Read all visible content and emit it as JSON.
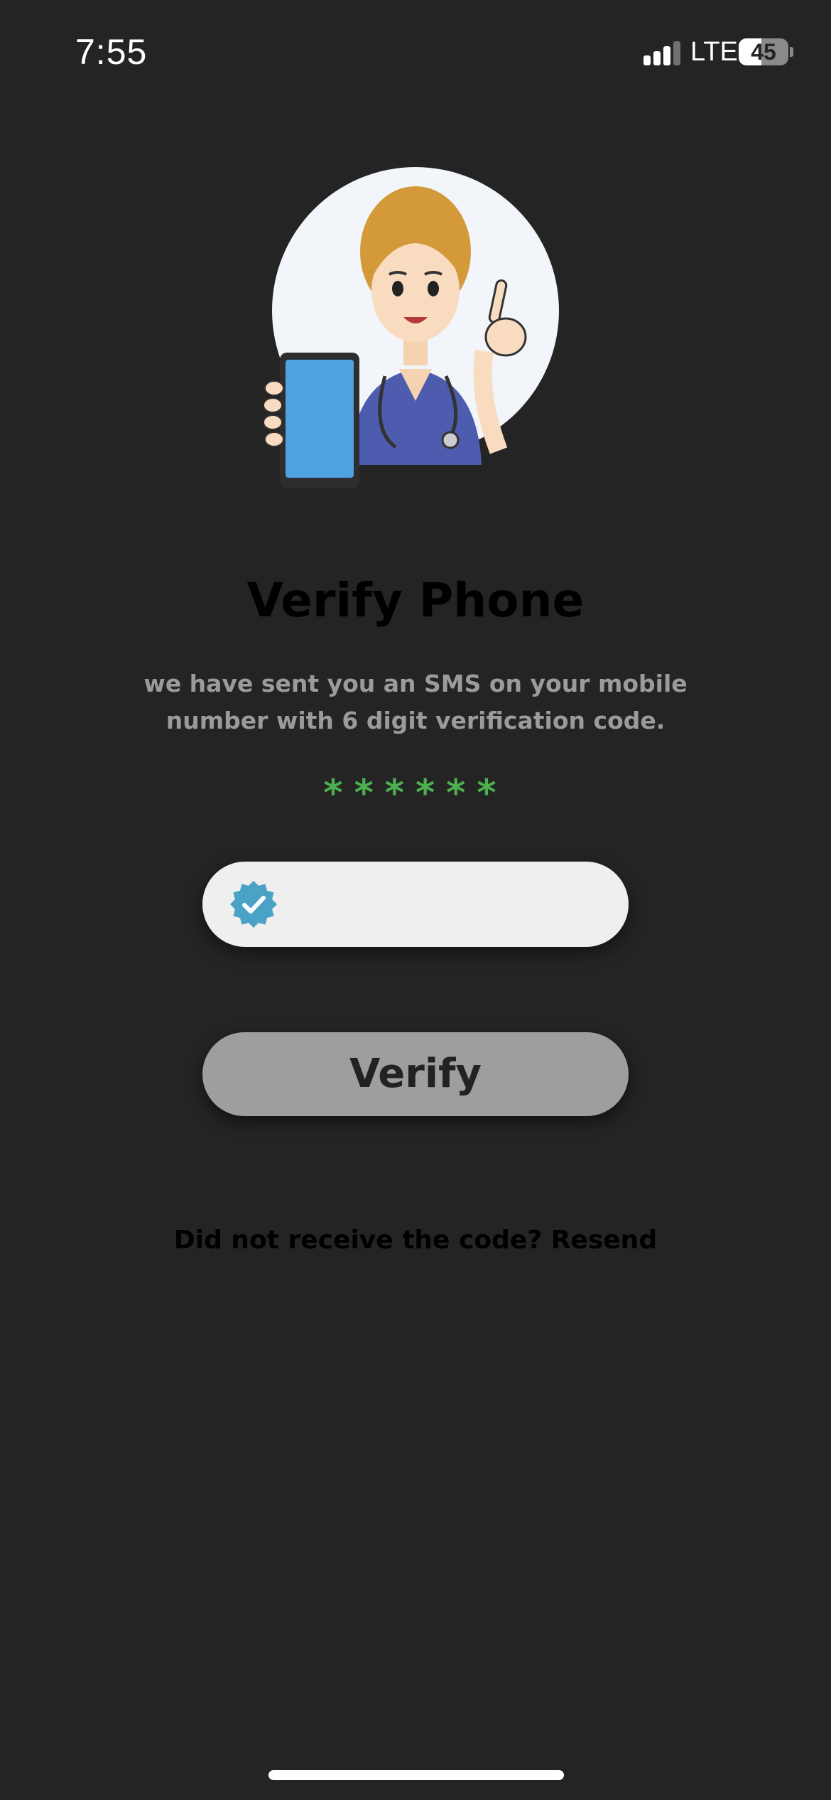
{
  "status_bar": {
    "time": "7:55",
    "carrier": "LTE",
    "battery_percent": "45",
    "battery_level": 0.45,
    "signal_bars": 3
  },
  "header": {
    "title": "Verify Phone",
    "subtitle": "we have sent you an SMS on your mobile number with 6 digit verification code.",
    "code_mask": "******"
  },
  "form": {
    "code_input_value": "",
    "code_input_placeholder": "",
    "verify_label": "Verify"
  },
  "resend": {
    "prompt": "Did not receive the code?",
    "link_label": "Resend"
  },
  "icons": {
    "verified": "verified-badge-icon",
    "signal": "signal-bars-icon",
    "battery": "battery-icon"
  },
  "colors": {
    "background": "#242424",
    "mask": "#4caf50",
    "verified_badge": "#4aa3c4",
    "button": "#9e9e9e",
    "input": "#efefef"
  }
}
